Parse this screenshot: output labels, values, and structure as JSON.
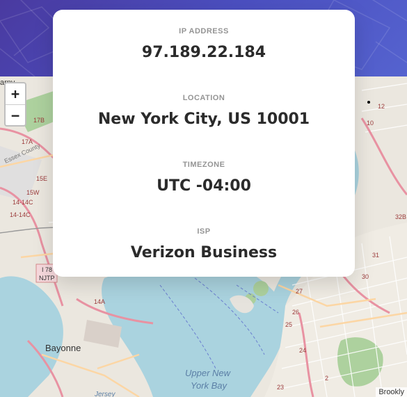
{
  "info": {
    "ip": {
      "label": "IP ADDRESS",
      "value": "97.189.22.184"
    },
    "location": {
      "label": "LOCATION",
      "value": "New York City, US 10001"
    },
    "timezone": {
      "label": "TIMEZONE",
      "value": "UTC -04:00"
    },
    "isp": {
      "label": "ISP",
      "value": "Verizon Business"
    }
  },
  "map": {
    "zoom_in_label": "+",
    "zoom_out_label": "−",
    "attribution": "Brookly",
    "place_labels": {
      "bayonne": "Bayonne",
      "upper_bay_1": "Upper New",
      "upper_bay_2": "York Bay",
      "essex": "Essex County",
      "arny": "arny",
      "njtp": "NJTP",
      "nj_route": "I 78",
      "jersey": "Jersey"
    },
    "exit_labels": {
      "e17b": "17B",
      "e17a": "17A",
      "e15e": "15E",
      "e15w": "15W",
      "e14c1": "14-14C",
      "e14c2": "14-14C",
      "e14a": "14A",
      "r12": "12",
      "r10": "10",
      "r32b": "32B",
      "r31": "31",
      "r30": "30",
      "r27": "27",
      "r26": "26",
      "r25": "25",
      "r24": "24",
      "r23": "23",
      "r2": "2"
    }
  },
  "colors": {
    "header_gradient_start": "#4a3aa0",
    "header_gradient_end": "#5563cf",
    "water": "#aad3df",
    "land": "#f2efe9",
    "park": "#add19e",
    "major_road": "#e892a2",
    "secondary_road": "#fcd6a4"
  }
}
